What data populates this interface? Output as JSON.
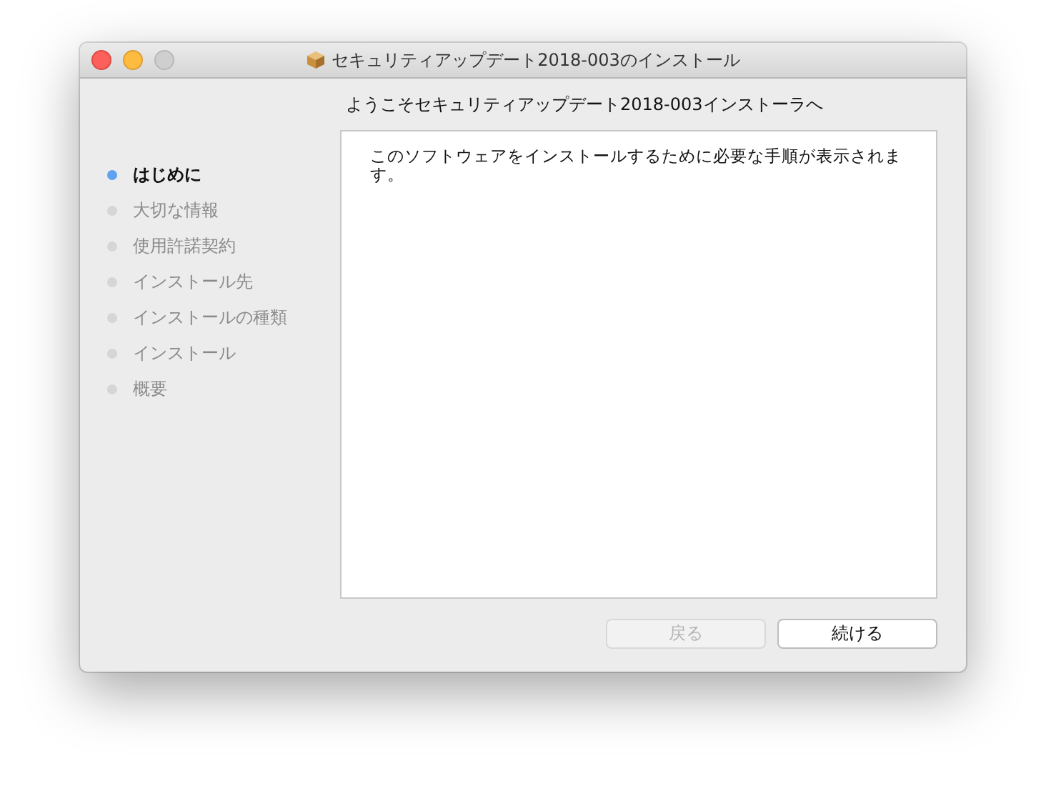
{
  "window": {
    "title": "セキュリティアップデート2018-003のインストール"
  },
  "heading": "ようこそセキュリティアップデート2018-003インストーラへ",
  "steps": [
    {
      "label": "はじめに",
      "selected": true
    },
    {
      "label": "大切な情報",
      "selected": false
    },
    {
      "label": "使用許諾契約",
      "selected": false
    },
    {
      "label": "インストール先",
      "selected": false
    },
    {
      "label": "インストールの種類",
      "selected": false
    },
    {
      "label": "インストール",
      "selected": false
    },
    {
      "label": "概要",
      "selected": false
    }
  ],
  "body": "このソフトウェアをインストールするために必要な手順が表示されます。",
  "buttons": [
    {
      "label": "戻る",
      "disabled": true
    },
    {
      "label": "続ける",
      "disabled": false
    }
  ]
}
